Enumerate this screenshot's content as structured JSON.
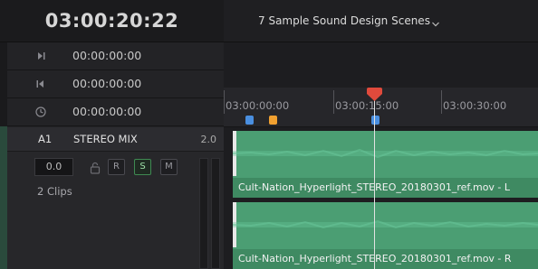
{
  "timecode": {
    "main": "03:00:20:22",
    "rows": [
      {
        "icon": "mark-in-icon",
        "value": "00:00:00:00"
      },
      {
        "icon": "mark-out-icon",
        "value": "00:00:00:00"
      },
      {
        "icon": "duration-clock-icon",
        "value": "00:00:00:00"
      }
    ]
  },
  "timeline": {
    "title": "7 Sample Sound Design Scenes",
    "ruler_labels": [
      "03:00:00:00",
      "03:00:15:00",
      "03:00:30:00"
    ]
  },
  "track": {
    "id": "A1",
    "name": "STEREO MIX",
    "format": "2.0",
    "volume": "0.0",
    "buttons": {
      "r": "R",
      "s": "S",
      "m": "M"
    },
    "clip_count": "2 Clips"
  },
  "clips": [
    {
      "name": "Cult-Nation_Hyperlight_STEREO_20180301_ref.mov - L"
    },
    {
      "name": "Cult-Nation_Hyperlight_STEREO_20180301_ref.mov - R"
    }
  ],
  "colors": {
    "clip_green": "#4b9e73",
    "playhead_red": "#e04a3c",
    "marker_blue": "#4a8fe0",
    "marker_orange": "#f0a030"
  }
}
